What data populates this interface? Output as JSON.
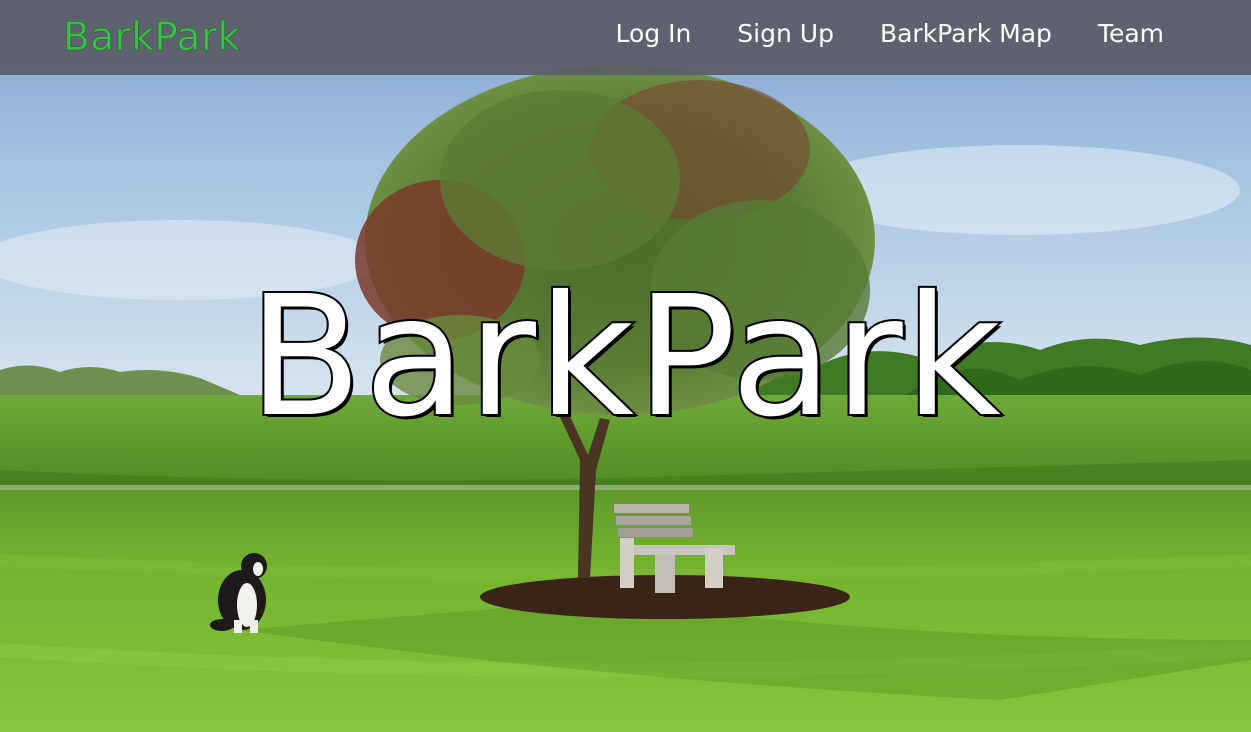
{
  "navbar": {
    "brand": "BarkPark",
    "links": [
      {
        "label": "Log In"
      },
      {
        "label": "Sign Up"
      },
      {
        "label": "BarkPark Map"
      },
      {
        "label": "Team"
      }
    ]
  },
  "hero": {
    "title": "BarkPark",
    "scene_icons": [
      "tree-icon",
      "bench-icon",
      "dog-icon"
    ]
  },
  "colors": {
    "brand_green": "#3dbd4a",
    "navbar_bg": "#5a5c66",
    "nav_text": "#ffffff",
    "sky_top": "#7fa2cf",
    "grass": "#6fae2a"
  }
}
